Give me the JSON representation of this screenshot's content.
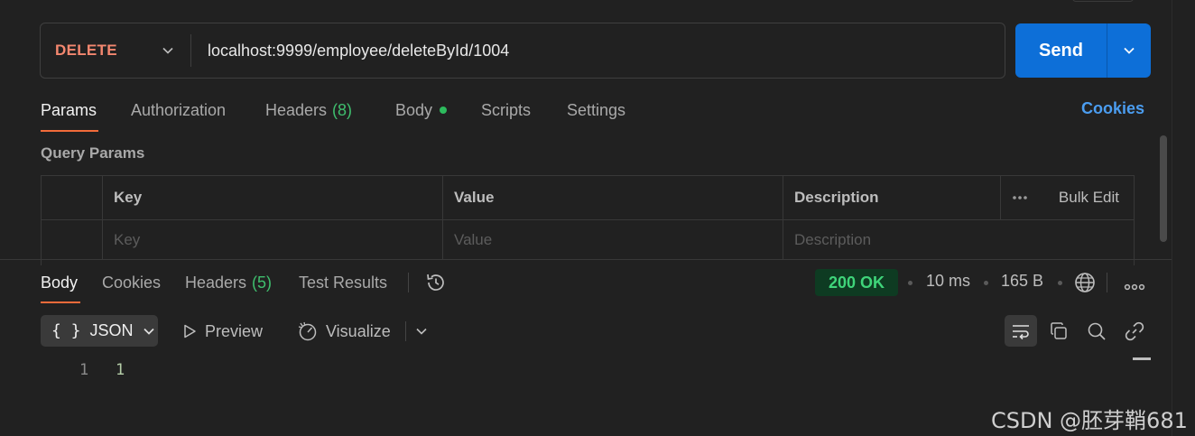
{
  "request": {
    "method": "DELETE",
    "url": "localhost:9999/employee/deleteById/1004",
    "send_label": "Send"
  },
  "request_tabs": {
    "params": "Params",
    "authorization": "Authorization",
    "headers": "Headers",
    "headers_count": "(8)",
    "body": "Body",
    "scripts": "Scripts",
    "settings": "Settings",
    "cookies": "Cookies"
  },
  "query_params": {
    "title": "Query Params",
    "columns": {
      "key": "Key",
      "value": "Value",
      "description": "Description",
      "bulk_edit": "Bulk Edit"
    },
    "placeholders": {
      "key": "Key",
      "value": "Value",
      "description": "Description"
    }
  },
  "response_tabs": {
    "body": "Body",
    "cookies": "Cookies",
    "headers": "Headers",
    "headers_count": "(5)",
    "test_results": "Test Results"
  },
  "response_meta": {
    "status": "200 OK",
    "time": "10 ms",
    "size": "165 B"
  },
  "response_toolbar": {
    "format": "JSON",
    "format_glyph": "{ }",
    "preview": "Preview",
    "visualize": "Visualize"
  },
  "response_body": {
    "lines": [
      {
        "number": "1",
        "content": "1"
      }
    ]
  },
  "watermark": "CSDN @胚芽鞘681",
  "colors": {
    "background": "#212121",
    "method": "#f4876f",
    "send": "#0d6fd8",
    "active_underline": "#f26b3a",
    "count_green": "#3fbf6e",
    "cookies_link": "#4b9df0",
    "status_bg": "#0e3b22",
    "status_text": "#3fd47a"
  }
}
